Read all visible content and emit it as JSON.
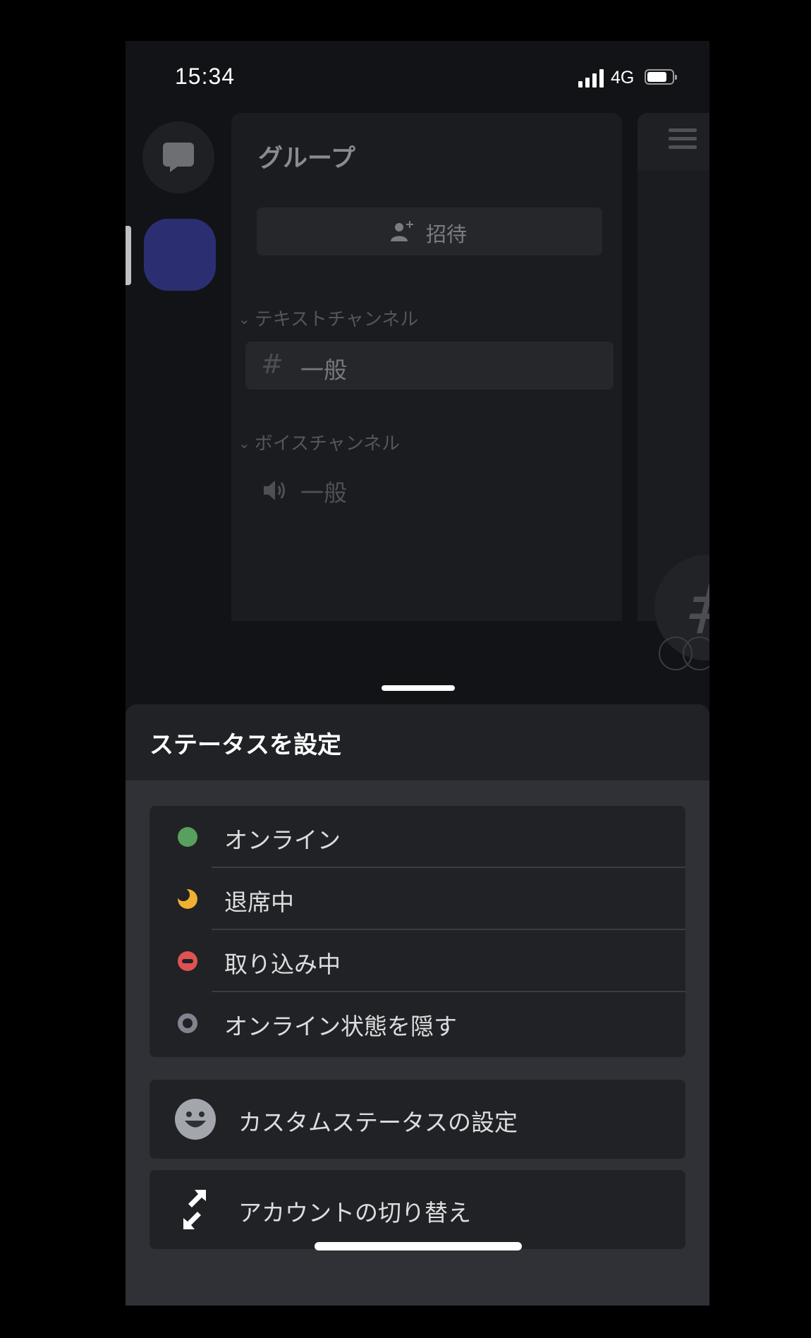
{
  "status_bar": {
    "time": "15:34",
    "network": "4G",
    "battery_level": 0.8
  },
  "server_rail": {
    "dm_icon": "chat-bubble-icon"
  },
  "channel_panel": {
    "guild_name": "グループ",
    "invite_label": "招待",
    "text_category": "テキストチャンネル",
    "text_channel_prefix": "#",
    "text_channel": "一般",
    "voice_category": "ボイスチャンネル",
    "voice_channel": "一般"
  },
  "chat_peek": {
    "channel_hash": "#"
  },
  "status_sheet": {
    "title": "ステータスを設定",
    "statuses": [
      {
        "label": "オンライン",
        "icon": "online-dot",
        "color": "#57a05d"
      },
      {
        "label": "退席中",
        "icon": "idle-moon",
        "color": "#f0b132"
      },
      {
        "label": "取り込み中",
        "icon": "dnd-minus",
        "color": "#e05252"
      },
      {
        "label": "オンライン状態を隠す",
        "icon": "invisible-ring",
        "color": "#80848e"
      }
    ],
    "custom_status_label": "カスタムステータスの設定",
    "switch_account_label": "アカウントの切り替え"
  }
}
